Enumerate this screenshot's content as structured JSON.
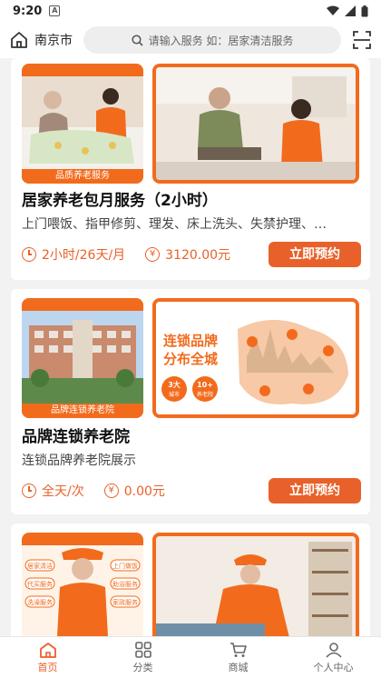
{
  "status": {
    "time": "9:20",
    "a_label": "A"
  },
  "header": {
    "city": "南京市",
    "search_placeholder": "请输入服务  如：居家清洁服务"
  },
  "cards": [
    {
      "image_caption": "品质养老服务",
      "title": "居家养老包月服务（2小时）",
      "description": "上门喂饭、指甲修剪、理发、床上洗头、失禁护理、…",
      "duration": "2小时/26天/月",
      "price": "3120.00元",
      "button": "立即预约"
    },
    {
      "image_caption": "品牌连锁养老院",
      "title": "品牌连锁养老院",
      "description": "连锁品牌养老院展示",
      "duration": "全天/次",
      "price": "0.00元",
      "button": "立即预约",
      "poster": {
        "headline_1": "连锁品牌",
        "headline_2": "分布全城",
        "badge_1": "3大",
        "badge_1b": "城市",
        "badge_2": "10+",
        "badge_2b": "养老院"
      }
    },
    {
      "image_caption": "",
      "title": "",
      "poster_tags": [
        "居家清洁",
        "上门做饭",
        "代买服务",
        "助浴服务",
        "洗澡服务",
        "家政服务"
      ]
    }
  ],
  "tabs": [
    {
      "label": "首页",
      "icon": "home-icon",
      "active": true
    },
    {
      "label": "分类",
      "icon": "grid-icon",
      "active": false
    },
    {
      "label": "商城",
      "icon": "cart-icon",
      "active": false
    },
    {
      "label": "个人中心",
      "icon": "user-icon",
      "active": false
    }
  ],
  "colors": {
    "accent": "#e8612a",
    "orange": "#f26b1d"
  }
}
